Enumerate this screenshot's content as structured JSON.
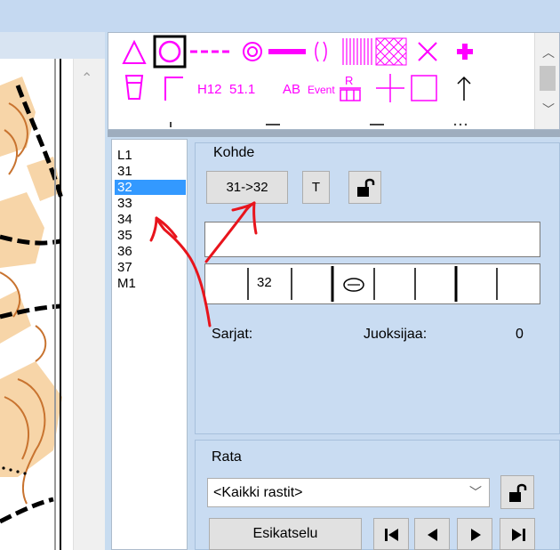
{
  "palette": {
    "symbols": [
      "triangle-icon",
      "circle-icon",
      "dashed-line-icon",
      "double-circle-icon",
      "thick-line-icon",
      "marked-route-icon",
      "hatched-area-icon",
      "crosshatch-area-icon",
      "cross-icon",
      "first-aid-icon",
      "refreshment-icon",
      "corner-icon",
      "h12-text-icon",
      "control-number-text-icon",
      "ab-text-icon",
      "event-text-icon",
      "registration-mark-icon",
      "plus-icon",
      "square-icon",
      "arrow-up-icon"
    ],
    "h12_label": "H12",
    "num_label": "51.1",
    "ab_label": "AB",
    "event_label": "Event",
    "reg_label": "R"
  },
  "controls": {
    "items": [
      "L1",
      "31",
      "32",
      "33",
      "34",
      "35",
      "36",
      "37",
      "M1"
    ],
    "selected": "32"
  },
  "kohde": {
    "title": "Kohde",
    "leg_button": "31->32",
    "text_button": "T",
    "lock_icon": "lock-open-icon",
    "text_value": "",
    "code_cell": "32",
    "sarjat_label": "Sarjat:",
    "juoksijaa_label": "Juoksijaa:",
    "juoksijaa_value": "0"
  },
  "rata": {
    "title": "Rata",
    "course_select": "<Kaikki rastit>",
    "preview_button": "Esikatselu",
    "nav_icons": [
      "first-icon",
      "previous-icon",
      "next-icon",
      "last-icon"
    ]
  },
  "colors": {
    "magenta": "#ff00ff",
    "annotation_red": "#e8141c",
    "selection": "#3399ff",
    "panel_bg": "#c9dcf2"
  }
}
